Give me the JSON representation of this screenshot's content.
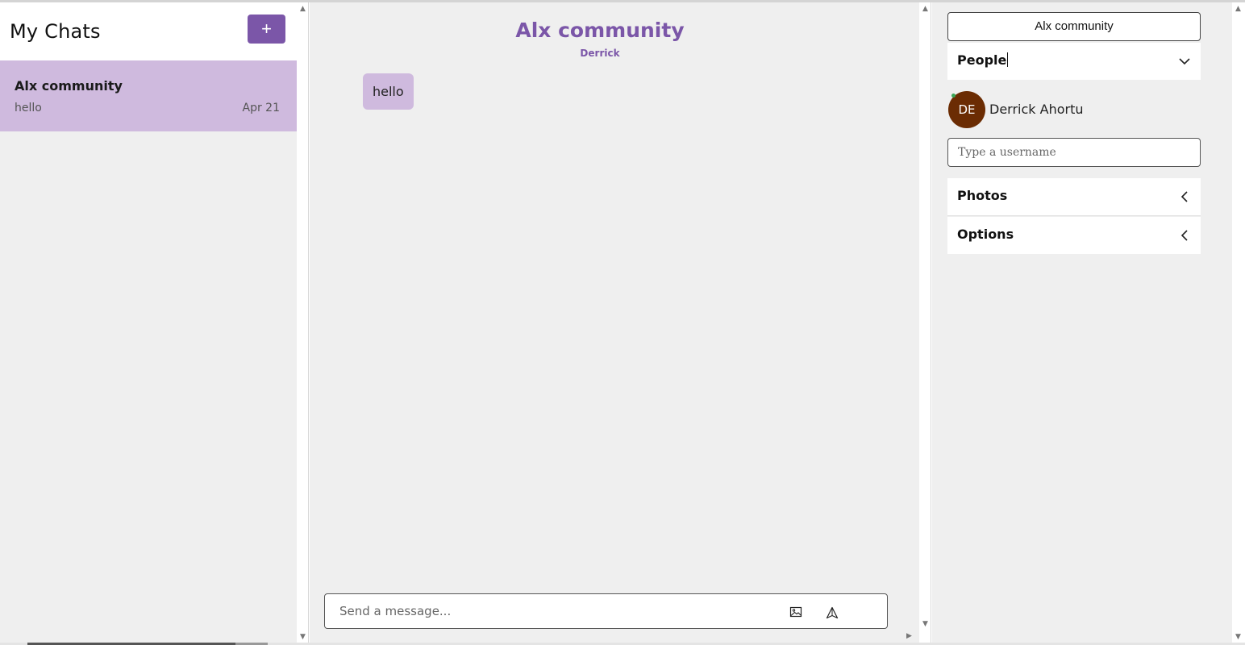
{
  "sidebar": {
    "title": "My Chats",
    "new_chat_label": "+",
    "chats": [
      {
        "name": "Alx community",
        "last_message": "hello",
        "date": "Apr 21"
      }
    ]
  },
  "conversation": {
    "title": "Alx community",
    "subtitle": "Derrick",
    "messages": [
      {
        "text": "hello"
      }
    ],
    "composer": {
      "placeholder": "Send a message...",
      "image_icon": "image-icon",
      "send_icon": "send-icon"
    }
  },
  "details": {
    "group_name": "Alx community",
    "people_label": "People",
    "members": [
      {
        "initials": "DE",
        "name": "Derrick Ahortu",
        "online": true
      }
    ],
    "search_placeholder": "Type a username",
    "photos_label": "Photos",
    "options_label": "Options"
  },
  "colors": {
    "accent": "#7b56a8",
    "selected_chat": "#cfbade",
    "avatar": "#6b2c03",
    "panel_bg": "#efefef",
    "online": "#3aa757"
  }
}
